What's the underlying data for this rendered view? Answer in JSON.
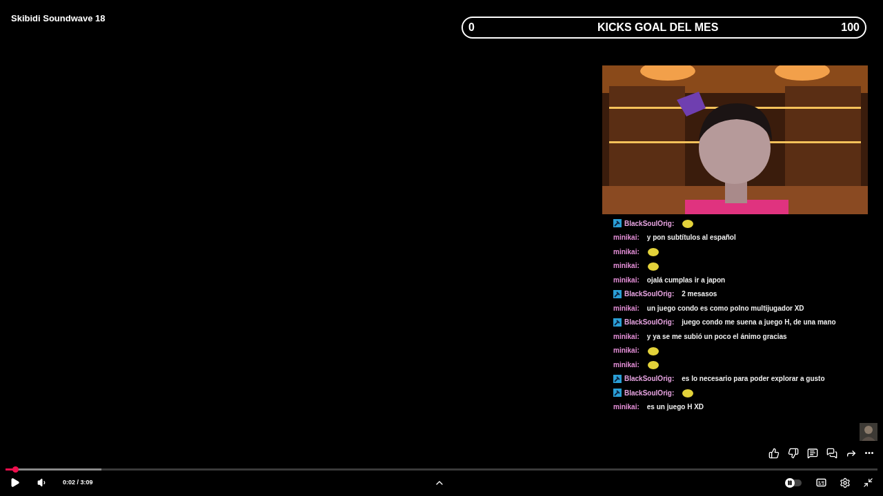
{
  "video_title": "Skibidi Soundwave 18",
  "goal": {
    "start": "0",
    "title": "KICKS GOAL DEL MES",
    "end": "100"
  },
  "chat": [
    {
      "user": "BlackSoulOrig:",
      "badge": true,
      "color": "#e6a3e0",
      "kind": "emote"
    },
    {
      "user": "minikai:",
      "badge": false,
      "color": "#e58fd8",
      "kind": "text",
      "text": "y pon subtítulos al español"
    },
    {
      "user": "minikai:",
      "badge": false,
      "color": "#e58fd8",
      "kind": "emote"
    },
    {
      "user": "minikai:",
      "badge": false,
      "color": "#e58fd8",
      "kind": "emote"
    },
    {
      "user": "minikai:",
      "badge": false,
      "color": "#e58fd8",
      "kind": "text",
      "text": "ojalá cumplas ir a japon"
    },
    {
      "user": "BlackSoulOrig:",
      "badge": true,
      "color": "#e6a3e0",
      "kind": "text",
      "text": "2 mesasos"
    },
    {
      "user": "minikai:",
      "badge": false,
      "color": "#e58fd8",
      "kind": "text",
      "text": "un juego condo es como polno multijugador XD"
    },
    {
      "user": "BlackSoulOrig:",
      "badge": true,
      "color": "#e6a3e0",
      "kind": "text",
      "text": "juego condo me suena a juego H, de una mano"
    },
    {
      "user": "minikai:",
      "badge": false,
      "color": "#e58fd8",
      "kind": "text",
      "text": "y ya se me subió un poco el ánimo gracias"
    },
    {
      "user": "minikai:",
      "badge": false,
      "color": "#e58fd8",
      "kind": "emote"
    },
    {
      "user": "minikai:",
      "badge": false,
      "color": "#e58fd8",
      "kind": "emote"
    },
    {
      "user": "BlackSoulOrig:",
      "badge": true,
      "color": "#e6a3e0",
      "kind": "text",
      "text": "es lo necesario para poder explorar a gusto"
    },
    {
      "user": "BlackSoulOrig:",
      "badge": true,
      "color": "#e6a3e0",
      "kind": "emote"
    },
    {
      "user": "minikai:",
      "badge": false,
      "color": "#e58fd8",
      "kind": "text",
      "text": "es un juego H XD"
    }
  ],
  "player": {
    "progress": {
      "level": 0.011
    },
    "buffered": {
      "level": 0.11
    },
    "time": "0:02 / 3:09",
    "autoplay": {
      "on": false
    }
  }
}
